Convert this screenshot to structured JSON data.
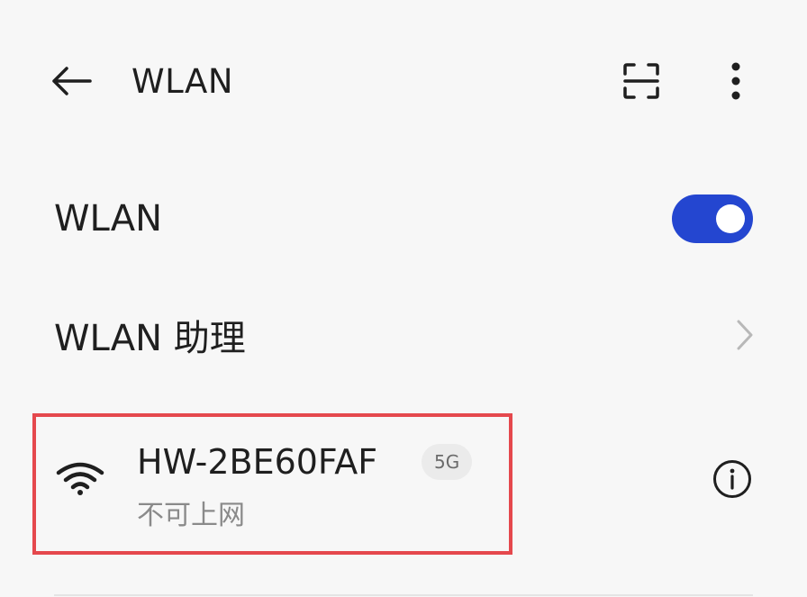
{
  "header": {
    "title": "WLAN",
    "back_icon": "arrow-left-icon",
    "scan_icon": "scan-icon",
    "more_icon": "more-vertical-icon"
  },
  "settings": {
    "wlan_toggle_label": "WLAN",
    "wlan_toggle_on": true,
    "assistant_label": "WLAN 助理"
  },
  "networks": [
    {
      "ssid": "HW-2BE60FAF",
      "band": "5G",
      "status": "不可上网",
      "highlighted": true
    }
  ],
  "colors": {
    "accent": "#2446d0",
    "highlight_border": "#e5484d",
    "background": "#f7f7f7"
  }
}
